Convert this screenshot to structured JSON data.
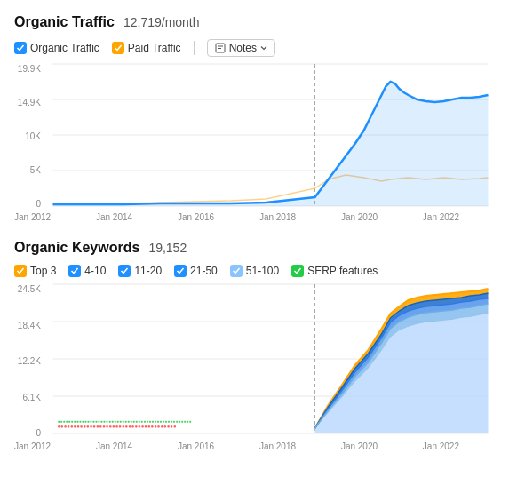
{
  "organicTraffic": {
    "title": "Organic Traffic",
    "value": "12,719/month",
    "legend": [
      {
        "id": "organic",
        "label": "Organic Traffic",
        "color": "#1E90FF",
        "checked": true
      },
      {
        "id": "paid",
        "label": "Paid Traffic",
        "color": "#FFA500",
        "checked": true
      }
    ],
    "notes_label": "Notes",
    "yAxis": [
      "19.9K",
      "14.9K",
      "10K",
      "5K",
      "0"
    ],
    "xAxis": [
      "Jan 2012",
      "Jan 2014",
      "Jan 2016",
      "Jan 2018",
      "Jan 2020",
      "Jan 2022"
    ]
  },
  "organicKeywords": {
    "title": "Organic Keywords",
    "value": "19,152",
    "legend": [
      {
        "id": "top3",
        "label": "Top 3",
        "color": "#FFA500",
        "checked": true
      },
      {
        "id": "4-10",
        "label": "4-10",
        "color": "#1E90FF",
        "checked": true
      },
      {
        "id": "11-20",
        "label": "11-20",
        "color": "#1E90FF",
        "checked": true
      },
      {
        "id": "21-50",
        "label": "21-50",
        "color": "#1E90FF",
        "checked": true
      },
      {
        "id": "51-100",
        "label": "51-100",
        "color": "#6EB6FF",
        "checked": true
      },
      {
        "id": "serp",
        "label": "SERP features",
        "color": "#22CC44",
        "checked": true
      }
    ],
    "yAxis": [
      "24.5K",
      "18.4K",
      "12.2K",
      "6.1K",
      "0"
    ],
    "xAxis": [
      "Jan 2012",
      "Jan 2014",
      "Jan 2016",
      "Jan 2018",
      "Jan 2020",
      "Jan 2022"
    ]
  }
}
